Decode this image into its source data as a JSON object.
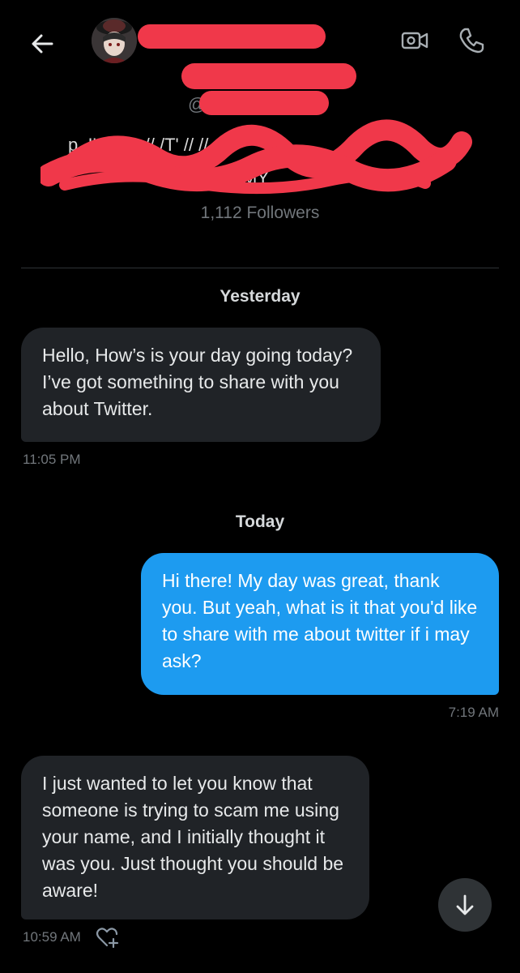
{
  "header": {
    "back_icon": "arrow-left-icon",
    "video_icon": "video-camera-icon",
    "call_icon": "phone-icon"
  },
  "profile": {
    "handle_prefix": "@",
    "bio_line1": "p, I'm C      r //     /T'      //       //  –",
    "bio_line2": "ahan         MY",
    "followers": "1,112 Followers"
  },
  "conversation": {
    "yesterday_label": "Yesterday",
    "today_label": "Today",
    "messages": [
      {
        "direction": "incoming",
        "text": "Hello, How’s is your day going today? I’ve got something to share with you about Twitter.",
        "time": "11:05 PM"
      },
      {
        "direction": "outgoing",
        "text": "Hi there! My day was great, thank you. But yeah, what is it that you'd like to share with me about twitter if i may ask?",
        "time": "7:19 AM"
      },
      {
        "direction": "incoming",
        "text": "I just wanted to let you know that someone is trying to scam me using your name, and I initially thought it was you. Just thought you should be aware!",
        "time": "10:59 AM"
      }
    ]
  },
  "reaction_icon": "add-reaction-heart-icon",
  "scroll_icon": "arrow-down-icon",
  "colors": {
    "background": "#000000",
    "incoming_bubble": "#202327",
    "outgoing_bubble": "#1d9bf0",
    "redaction": "#f0384a"
  }
}
